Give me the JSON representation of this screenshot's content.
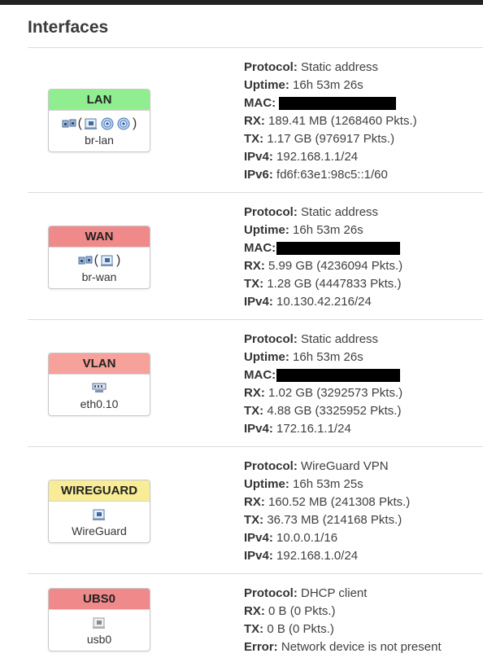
{
  "page": {
    "title": "Interfaces"
  },
  "colors": {
    "lan": "#90ee90",
    "wan": "#f08a8a",
    "vlan": "#f6a29a",
    "wireguard": "#f8ec96",
    "usb": "#f08a8a"
  },
  "interfaces": [
    {
      "name": "LAN",
      "device": "br-lan",
      "icons": [
        "bridge-icon",
        "ethernet-port-icon",
        "wifi-icon",
        "wifi-icon"
      ],
      "details": [
        {
          "label": "Protocol:",
          "value": "Static address"
        },
        {
          "label": "Uptime:",
          "value": "16h 53m 26s"
        },
        {
          "label": "MAC:",
          "value": ""
        },
        {
          "label": "RX:",
          "value": "189.41 MB (1268460 Pkts.)"
        },
        {
          "label": "TX:",
          "value": "1.17 GB (976917 Pkts.)"
        },
        {
          "label": "IPv4:",
          "value": "192.168.1.1/24"
        },
        {
          "label": "IPv6:",
          "value": "fd6f:63e1:98c5::1/60"
        }
      ]
    },
    {
      "name": "WAN",
      "device": "br-wan",
      "icons": [
        "bridge-icon",
        "ethernet-port-icon"
      ],
      "details": [
        {
          "label": "Protocol:",
          "value": "Static address"
        },
        {
          "label": "Uptime:",
          "value": "16h 53m 26s"
        },
        {
          "label": "MAC:",
          "value": ""
        },
        {
          "label": "RX:",
          "value": "5.99 GB (4236094 Pkts.)"
        },
        {
          "label": "TX:",
          "value": "1.28 GB (4447833 Pkts.)"
        },
        {
          "label": "IPv4:",
          "value": "10.130.42.216/24"
        }
      ]
    },
    {
      "name": "VLAN",
      "device": "eth0.10",
      "icons": [
        "switch-icon"
      ],
      "details": [
        {
          "label": "Protocol:",
          "value": "Static address"
        },
        {
          "label": "Uptime:",
          "value": "16h 53m 26s"
        },
        {
          "label": "MAC:",
          "value": ""
        },
        {
          "label": "RX:",
          "value": "1.02 GB (3292573 Pkts.)"
        },
        {
          "label": "TX:",
          "value": "4.88 GB (3325952 Pkts.)"
        },
        {
          "label": "IPv4:",
          "value": "172.16.1.1/24"
        }
      ]
    },
    {
      "name": "WIREGUARD",
      "device": "WireGuard",
      "icons": [
        "ethernet-port-icon"
      ],
      "details": [
        {
          "label": "Protocol:",
          "value": "WireGuard VPN"
        },
        {
          "label": "Uptime:",
          "value": "16h 53m 25s"
        },
        {
          "label": "RX:",
          "value": "160.52 MB (241308 Pkts.)"
        },
        {
          "label": "TX:",
          "value": "36.73 MB (214168 Pkts.)"
        },
        {
          "label": "IPv4:",
          "value": "10.0.0.1/16"
        },
        {
          "label": "IPv4:",
          "value": "192.168.1.0/24"
        }
      ]
    },
    {
      "name": "UBS0",
      "device": "usb0",
      "icons": [
        "ethernet-port-disabled-icon"
      ],
      "details": [
        {
          "label": "Protocol:",
          "value": "DHCP client"
        },
        {
          "label": "RX:",
          "value": "0 B (0 Pkts.)"
        },
        {
          "label": "TX:",
          "value": "0 B (0 Pkts.)"
        },
        {
          "label": "Error:",
          "value": "Network device is not present"
        }
      ]
    }
  ]
}
